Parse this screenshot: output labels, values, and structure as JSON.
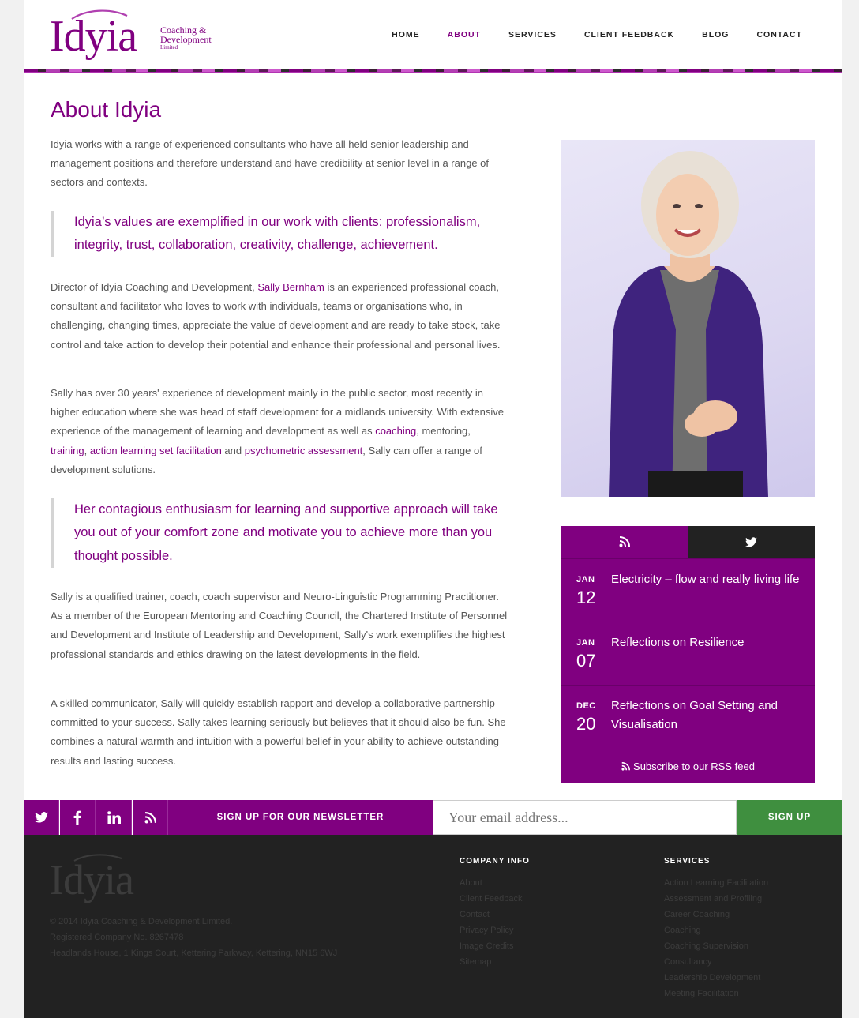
{
  "brand": {
    "name": "Idyia",
    "tagline_line1": "Coaching &",
    "tagline_line2": "Development",
    "tagline_line3": "Limited",
    "accent": "#800080"
  },
  "nav": {
    "items": [
      {
        "label": "HOME"
      },
      {
        "label": "ABOUT"
      },
      {
        "label": "SERVICES"
      },
      {
        "label": "CLIENT FEEDBACK"
      },
      {
        "label": "BLOG"
      },
      {
        "label": "CONTACT"
      }
    ],
    "active": "ABOUT"
  },
  "main": {
    "title": "About Idyia",
    "intro": "Idyia works with a range of experienced consultants who have all held senior leadership and management positions and therefore understand and have credibility at senior level in a range of sectors and contexts.",
    "quote1": "Idyia’s values are exemplified in our work with clients: professionalism, integrity, trust, collaboration, creativity, challenge, achievement.",
    "p2_before": "Director of Idyia Coaching and Development, ",
    "p2_link": "Sally Bernham",
    "p2_after": " is an experienced professional coach, consultant and facilitator who loves to work with individuals, teams or organisations who, in challenging, changing times, appreciate the value of development and are ready to take stock, take control and take action to develop their potential and enhance their professional and personal lives.",
    "p3_a": "Sally has over 30 years' experience of development mainly in the public sector, most recently in higher education where she was head of staff development for a midlands university. With extensive experience of the management of learning and development as well as ",
    "p3_link_coaching": "coaching",
    "p3_b": ", mentoring, ",
    "p3_link_training": "training",
    "p3_c": ", ",
    "p3_link_als": "action learning set facilitation",
    "p3_d": " and ",
    "p3_link_psy": "psychometric assessment",
    "p3_e": ", Sally can offer a range of development solutions.",
    "quote2": "Her contagious enthusiasm for learning and supportive approach will take you out of your comfort zone and motivate you to achieve more than you thought possible.",
    "p4": "Sally is a qualified trainer, coach, coach supervisor and Neuro-Linguistic Programming Practitioner. As a member of the European Mentoring and Coaching Council, the Chartered Institute of Personnel and Development and Institute of Leadership and Development, Sally's work exemplifies the highest professional standards and ethics drawing on the latest developments in the field.",
    "p5": "A skilled communicator, Sally will quickly establish rapport and develop a collaborative partnership committed to your success. Sally takes learning seriously but believes that it should also be fun. She combines a natural warmth and intuition with a powerful belief in your ability to achieve outstanding results and lasting success."
  },
  "widget": {
    "tabs": [
      {
        "icon": "rss-icon"
      },
      {
        "icon": "twitter-icon"
      }
    ],
    "posts": [
      {
        "month": "JAN",
        "day": "12",
        "title": "Electricity – flow and really living life"
      },
      {
        "month": "JAN",
        "day": "07",
        "title": "Reflections on Resilience"
      },
      {
        "month": "DEC",
        "day": "20",
        "title": "Reflections on Goal Setting and Visualisation"
      }
    ],
    "subscribe": "Subscribe to our RSS feed"
  },
  "newsletter": {
    "label": "SIGN UP FOR OUR NEWSLETTER",
    "placeholder": "Your email address...",
    "button": "SIGN UP",
    "social": [
      "twitter-icon",
      "facebook-icon",
      "linkedin-icon",
      "rss-icon"
    ]
  },
  "footer": {
    "logo": "Idyia",
    "copyright": "© 2014 Idyia Coaching & Development Limited.",
    "company_no": "Registered Company No. 8267478",
    "address": "Headlands House, 1 Kings Court, Kettering Parkway, Kettering, NN15 6WJ",
    "company_info": {
      "heading": "COMPANY INFO",
      "links": [
        "About",
        "Client Feedback",
        "Contact",
        "Privacy Policy",
        "Image Credits",
        "Sitemap"
      ]
    },
    "services": {
      "heading": "SERVICES",
      "links": [
        "Action Learning Facilitation",
        "Assessment and Profiling",
        "Career Coaching",
        "Coaching",
        "Coaching Supervision",
        "Consultancy",
        "Leadership Development",
        "Meeting Facilitation"
      ]
    }
  }
}
